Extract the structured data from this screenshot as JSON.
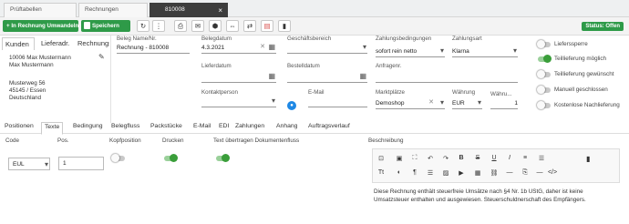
{
  "file_tabs": [
    {
      "label": "Prüftabellen"
    },
    {
      "label": "Rechnungen"
    },
    {
      "label": "810008",
      "close": "×"
    }
  ],
  "toolbar": {
    "convert_label": "+ In Rechnung Umwandeln",
    "save_label": "Speichern",
    "status_label": "Status: Offen"
  },
  "left_tabs": [
    {
      "label": "Kunden"
    },
    {
      "label": "Lieferadr."
    },
    {
      "label": "Rechnungsadr."
    }
  ],
  "address": {
    "line1": "10006 Max Mustermann",
    "line2": "Max Mustermann",
    "line3": "Musterweg 56",
    "line4": "45145 / Essen",
    "line5": "Deutschland"
  },
  "form": {
    "beleg_label": "Beleg Name/Nr.",
    "beleg_value": "Rechnung - 810008",
    "belegdatum_label": "Belegdatum",
    "belegdatum_value": "4.3.2021",
    "geschaeftsbereich_label": "Geschäftsbereich",
    "zahlungsbed_label": "Zahlungsbedingungen",
    "zahlungsbed_value": "sofort rein netto",
    "zahlungsart_label": "Zahlungsart",
    "zahlungsart_value": "Klarna",
    "lieferdatum_label": "Lieferdatum",
    "bestelldatum_label": "Bestelldatum",
    "anfragenr_label": "Anfragenr.",
    "kontakt_label": "Kontaktperson",
    "email_label": "E-Mail",
    "marktplatz_label": "Marktplätze",
    "marktplatz_value": "Demoshop",
    "waehrung_label": "Währung",
    "waehrung_value": "EUR",
    "waehrungskurs_label": "Währu...",
    "waehrungskurs_value": "1"
  },
  "toggles": [
    {
      "label": "Lieferssperre",
      "on": false
    },
    {
      "label": "Teillieferung möglich",
      "on": true
    },
    {
      "label": "Teillieferung gewünscht",
      "on": false
    },
    {
      "label": "Manuell geschlossen",
      "on": false
    },
    {
      "label": "Kostenlose Nachlieferung",
      "on": false
    }
  ],
  "nav_tabs": [
    {
      "label": "Positionen"
    },
    {
      "label": "Texte"
    },
    {
      "label": "Bedingung"
    },
    {
      "label": "Belegfluss"
    },
    {
      "label": "Packstücke"
    },
    {
      "label": "E-Mail"
    },
    {
      "label": "EDI"
    },
    {
      "label": "Zahlungen"
    },
    {
      "label": "Anhang"
    },
    {
      "label": "Auftragsverlauf"
    }
  ],
  "texte": {
    "col_code": "Code",
    "col_pos": "Pos.",
    "col_kopfposition": "Kopfposition",
    "col_drucken": "Drucken",
    "col_text_uebertragen": "Text übertragen Dokumentenfluss",
    "col_beschreibung": "Beschreibung",
    "code_value": "EUL",
    "pos_value": "1",
    "kopfposition_on": false,
    "drucken_on": true,
    "text_uebertragen_on": true,
    "description": "Diese Rechnung enthält steuerfreie Umsätze nach §4 Nr. 1b UStG, daher ist keine Umsatzsteuer enthalten und ausgewiesen. Steuerschuldnerschaft des Empfängers."
  },
  "colors": {
    "green": "#2e9a48",
    "dark_tab": "#3d3d3d",
    "accent_red": "#d9534f",
    "avatar_blue": "#1e88e5"
  }
}
